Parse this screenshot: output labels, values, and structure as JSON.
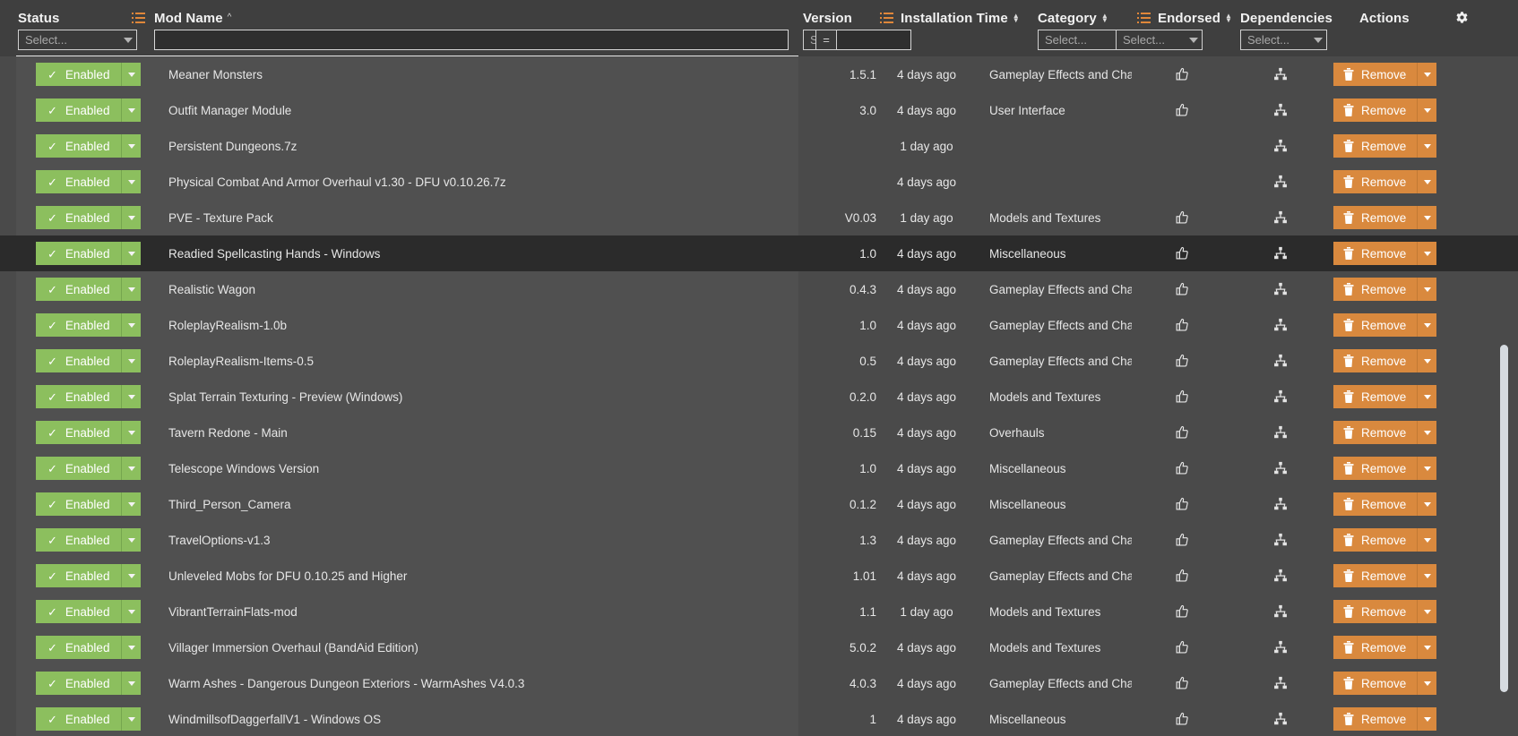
{
  "header": {
    "columns": [
      {
        "label": "Status",
        "sort": "",
        "filter_type": "select",
        "filter_value": "Select...",
        "has_filter_icon": true
      },
      {
        "label": "Mod Name",
        "sort": "asc",
        "filter_type": "text",
        "filter_value": "",
        "has_filter_icon": false
      },
      {
        "label": "Version",
        "sort": "",
        "filter_type": "select",
        "filter_value": "Select...",
        "has_filter_icon": false
      },
      {
        "label": "Installation Time",
        "sort": "both",
        "filter_type": "eqtext",
        "filter_value": "",
        "filter_prefix": "=",
        "has_filter_icon": true
      },
      {
        "label": "Category",
        "sort": "both",
        "filter_type": "select",
        "filter_value": "Select...",
        "has_filter_icon": false
      },
      {
        "label": "Endorsed",
        "sort": "both",
        "filter_type": "select",
        "filter_value": "Select...",
        "has_filter_icon": true
      },
      {
        "label": "Dependencies",
        "sort": "",
        "filter_type": "select",
        "filter_value": "Select...",
        "has_filter_icon": false
      },
      {
        "label": "Actions",
        "sort": "",
        "filter_type": "none",
        "filter_value": "",
        "has_filter_icon": false
      }
    ],
    "settings_icon": "gear-icon",
    "sort_asc_glyph": "^"
  },
  "labels": {
    "enabled": "Enabled",
    "remove": "Remove",
    "check_glyph": "✓"
  },
  "colors": {
    "enabled_green": "#8cbf5e",
    "remove_orange": "#d9893e",
    "filter_accent": "#e0873a",
    "row_background": "#4a4a4a",
    "selected_row": "#2b2b2b",
    "header_background": "#3f3f3f"
  },
  "rows": [
    {
      "status": "Enabled",
      "name": "Meaner Monsters",
      "version": "1.5.1",
      "time": "4 days ago",
      "category": "Gameplay Effects and Changes",
      "endorsed": true,
      "dependencies": true,
      "action": "Remove",
      "selected": false
    },
    {
      "status": "Enabled",
      "name": "Outfit Manager Module",
      "version": "3.0",
      "time": "4 days ago",
      "category": "User Interface",
      "endorsed": true,
      "dependencies": true,
      "action": "Remove",
      "selected": false
    },
    {
      "status": "Enabled",
      "name": "Persistent Dungeons.7z",
      "version": "",
      "time": "1 day ago",
      "category": "",
      "endorsed": false,
      "dependencies": true,
      "action": "Remove",
      "selected": false
    },
    {
      "status": "Enabled",
      "name": "Physical Combat And Armor Overhaul v1.30 - DFU v0.10.26.7z",
      "version": "",
      "time": "4 days ago",
      "category": "",
      "endorsed": false,
      "dependencies": true,
      "action": "Remove",
      "selected": false
    },
    {
      "status": "Enabled",
      "name": "PVE - Texture Pack",
      "version": "V0.03",
      "time": "1 day ago",
      "category": "Models and Textures",
      "endorsed": true,
      "dependencies": true,
      "action": "Remove",
      "selected": false
    },
    {
      "status": "Enabled",
      "name": "Readied Spellcasting Hands - Windows",
      "version": "1.0",
      "time": "4 days ago",
      "category": "Miscellaneous",
      "endorsed": true,
      "dependencies": true,
      "action": "Remove",
      "selected": true
    },
    {
      "status": "Enabled",
      "name": "Realistic Wagon",
      "version": "0.4.3",
      "time": "4 days ago",
      "category": "Gameplay Effects and Changes",
      "endorsed": true,
      "dependencies": true,
      "action": "Remove",
      "selected": false
    },
    {
      "status": "Enabled",
      "name": "RoleplayRealism-1.0b",
      "version": "1.0",
      "time": "4 days ago",
      "category": "Gameplay Effects and Changes",
      "endorsed": true,
      "dependencies": true,
      "action": "Remove",
      "selected": false
    },
    {
      "status": "Enabled",
      "name": "RoleplayRealism-Items-0.5",
      "version": "0.5",
      "time": "4 days ago",
      "category": "Gameplay Effects and Changes",
      "endorsed": true,
      "dependencies": true,
      "action": "Remove",
      "selected": false
    },
    {
      "status": "Enabled",
      "name": "Splat Terrain Texturing - Preview (Windows)",
      "version": "0.2.0",
      "time": "4 days ago",
      "category": "Models and Textures",
      "endorsed": true,
      "dependencies": true,
      "action": "Remove",
      "selected": false
    },
    {
      "status": "Enabled",
      "name": "Tavern Redone - Main",
      "version": "0.15",
      "time": "4 days ago",
      "category": "Overhauls",
      "endorsed": true,
      "dependencies": true,
      "action": "Remove",
      "selected": false
    },
    {
      "status": "Enabled",
      "name": "Telescope Windows Version",
      "version": "1.0",
      "time": "4 days ago",
      "category": "Miscellaneous",
      "endorsed": true,
      "dependencies": true,
      "action": "Remove",
      "selected": false
    },
    {
      "status": "Enabled",
      "name": "Third_Person_Camera",
      "version": "0.1.2",
      "time": "4 days ago",
      "category": "Miscellaneous",
      "endorsed": true,
      "dependencies": true,
      "action": "Remove",
      "selected": false
    },
    {
      "status": "Enabled",
      "name": "TravelOptions-v1.3",
      "version": "1.3",
      "time": "4 days ago",
      "category": "Gameplay Effects and Changes",
      "endorsed": true,
      "dependencies": true,
      "action": "Remove",
      "selected": false
    },
    {
      "status": "Enabled",
      "name": "Unleveled Mobs for DFU 0.10.25 and Higher",
      "version": "1.01",
      "time": "4 days ago",
      "category": "Gameplay Effects and Changes",
      "endorsed": true,
      "dependencies": true,
      "action": "Remove",
      "selected": false
    },
    {
      "status": "Enabled",
      "name": "VibrantTerrainFlats-mod",
      "version": "1.1",
      "time": "1 day ago",
      "category": "Models and Textures",
      "endorsed": true,
      "dependencies": true,
      "action": "Remove",
      "selected": false
    },
    {
      "status": "Enabled",
      "name": "Villager Immersion Overhaul (BandAid Edition)",
      "version": "5.0.2",
      "time": "4 days ago",
      "category": "Models and Textures",
      "endorsed": true,
      "dependencies": true,
      "action": "Remove",
      "selected": false
    },
    {
      "status": "Enabled",
      "name": "Warm Ashes - Dangerous Dungeon Exteriors - WarmAshes V4.0.3",
      "version": "4.0.3",
      "time": "4 days ago",
      "category": "Gameplay Effects and Changes",
      "endorsed": true,
      "dependencies": true,
      "action": "Remove",
      "selected": false
    },
    {
      "status": "Enabled",
      "name": "WindmillsofDaggerfallV1 - Windows OS",
      "version": "1",
      "time": "4 days ago",
      "category": "Miscellaneous",
      "endorsed": true,
      "dependencies": true,
      "action": "Remove",
      "selected": false
    }
  ]
}
